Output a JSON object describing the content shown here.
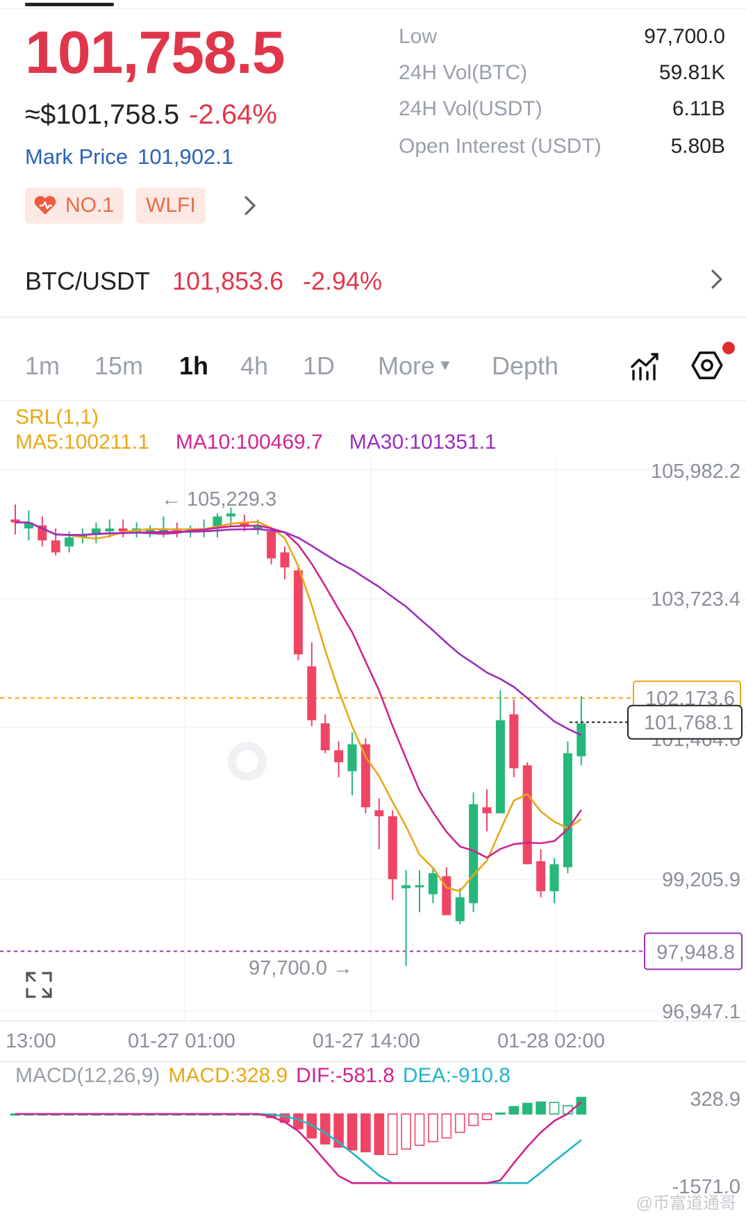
{
  "header": {
    "last_price": "101,758.5",
    "usd_price": "≈$101,758.5",
    "change_pct": "-2.64%",
    "mark_price_label": "Mark Price",
    "mark_price_value": "101,902.1",
    "tags": [
      {
        "label": "NO.1",
        "icon": "heart-icon"
      },
      {
        "label": "WLFI"
      }
    ]
  },
  "stats": [
    {
      "label": "Low",
      "value": "97,700.0"
    },
    {
      "label": "24H Vol(BTC)",
      "value": "59.81K"
    },
    {
      "label": "24H Vol(USDT)",
      "value": "6.11B"
    },
    {
      "label": "Open Interest (USDT)",
      "value": "5.80B"
    }
  ],
  "pair": {
    "name": "BTC/USDT",
    "price": "101,853.6",
    "change": "-2.94%"
  },
  "intervals": {
    "items": [
      "1m",
      "15m",
      "1h",
      "4h",
      "1D",
      "More",
      "Depth"
    ],
    "active": "1h"
  },
  "indicators": {
    "srl": "SRL(1,1)",
    "ma5": "MA5:100211.1",
    "ma10": "MA10:100469.7",
    "ma30": "MA30:101351.1"
  },
  "colors": {
    "up": "#26b77a",
    "down": "#ef4565",
    "ma5": "#e6a817",
    "ma10": "#d0248f",
    "ma30": "#9c2dbb",
    "dea": "#21b5c6",
    "accent_red": "#e0364a",
    "link_blue": "#2a62b8"
  },
  "chart_data": {
    "type": "candlestick",
    "price_axis_labels": [
      "105,982.2",
      "103,723.4",
      "101,464.6",
      "99,205.9",
      "96,947.1"
    ],
    "time_axis_labels": [
      "13:00",
      "01-27 01:00",
      "01-27 14:00",
      "01-28 02:00"
    ],
    "high_marker": "105,229.3",
    "low_marker": "97,700.0",
    "srl_line": "102,173.6",
    "current_price_tag": "101,768.1",
    "purple_line": "97,948.8",
    "candles": [
      {
        "o": 105150,
        "h": 105400,
        "l": 104900,
        "c": 105100
      },
      {
        "o": 105000,
        "h": 105300,
        "l": 104800,
        "c": 105100
      },
      {
        "o": 105050,
        "h": 105200,
        "l": 104700,
        "c": 104800
      },
      {
        "o": 104800,
        "h": 105000,
        "l": 104550,
        "c": 104600
      },
      {
        "o": 104700,
        "h": 104950,
        "l": 104600,
        "c": 104850
      },
      {
        "o": 104850,
        "h": 105000,
        "l": 104750,
        "c": 104900
      },
      {
        "o": 104900,
        "h": 105100,
        "l": 104750,
        "c": 105000
      },
      {
        "o": 104950,
        "h": 105150,
        "l": 104850,
        "c": 105000
      },
      {
        "o": 105000,
        "h": 105150,
        "l": 104850,
        "c": 104950
      },
      {
        "o": 104950,
        "h": 105100,
        "l": 104850,
        "c": 105000
      },
      {
        "o": 104950,
        "h": 105050,
        "l": 104850,
        "c": 105000
      },
      {
        "o": 104950,
        "h": 105200,
        "l": 104850,
        "c": 105000
      },
      {
        "o": 105000,
        "h": 105100,
        "l": 104850,
        "c": 104950
      },
      {
        "o": 104950,
        "h": 105050,
        "l": 104850,
        "c": 105000
      },
      {
        "o": 104950,
        "h": 105150,
        "l": 104850,
        "c": 105000
      },
      {
        "o": 105000,
        "h": 105250,
        "l": 104850,
        "c": 105200
      },
      {
        "o": 105200,
        "h": 105350,
        "l": 105050,
        "c": 105250
      },
      {
        "o": 105100,
        "h": 105230,
        "l": 104950,
        "c": 105050
      },
      {
        "o": 105000,
        "h": 105150,
        "l": 104900,
        "c": 105050
      },
      {
        "o": 104950,
        "h": 105000,
        "l": 104400,
        "c": 104500
      },
      {
        "o": 104600,
        "h": 104700,
        "l": 104150,
        "c": 104350
      },
      {
        "o": 104300,
        "h": 104400,
        "l": 102800,
        "c": 102900
      },
      {
        "o": 102700,
        "h": 103100,
        "l": 101700,
        "c": 101800
      },
      {
        "o": 101750,
        "h": 101900,
        "l": 101250,
        "c": 101300
      },
      {
        "o": 101300,
        "h": 101450,
        "l": 100850,
        "c": 101100
      },
      {
        "o": 100950,
        "h": 101600,
        "l": 100550,
        "c": 101400
      },
      {
        "o": 101400,
        "h": 101500,
        "l": 100250,
        "c": 100350
      },
      {
        "o": 100300,
        "h": 100500,
        "l": 99650,
        "c": 100200
      },
      {
        "o": 100200,
        "h": 100300,
        "l": 98800,
        "c": 99150
      },
      {
        "o": 99000,
        "h": 99300,
        "l": 97700,
        "c": 99050
      },
      {
        "o": 99050,
        "h": 99300,
        "l": 98600,
        "c": 99050
      },
      {
        "o": 98900,
        "h": 99350,
        "l": 98750,
        "c": 99250
      },
      {
        "o": 99200,
        "h": 99350,
        "l": 98600,
        "c": 98550
      },
      {
        "o": 98450,
        "h": 99000,
        "l": 98400,
        "c": 98850
      },
      {
        "o": 98750,
        "h": 100600,
        "l": 98600,
        "c": 100400
      },
      {
        "o": 100350,
        "h": 100650,
        "l": 99950,
        "c": 100250
      },
      {
        "o": 100250,
        "h": 102300,
        "l": 100250,
        "c": 101800
      },
      {
        "o": 101900,
        "h": 102150,
        "l": 100850,
        "c": 101000
      },
      {
        "o": 101050,
        "h": 101100,
        "l": 99400,
        "c": 99400
      },
      {
        "o": 99450,
        "h": 99650,
        "l": 98850,
        "c": 98950
      },
      {
        "o": 98950,
        "h": 99500,
        "l": 98750,
        "c": 99400
      },
      {
        "o": 99350,
        "h": 101450,
        "l": 99250,
        "c": 101250
      },
      {
        "o": 101200,
        "h": 102200,
        "l": 101050,
        "c": 101750
      }
    ]
  },
  "macd": {
    "label": "MACD(12,26,9)",
    "macd": "MACD:328.9",
    "dif": "DIF:-581.8",
    "dea": "DEA:-910.8",
    "axis_top": "328.9",
    "axis_bottom": "-1571.0",
    "histogram": [
      0,
      0,
      0,
      0,
      0,
      0,
      0,
      0,
      0,
      0,
      0,
      0,
      0,
      0,
      0,
      0,
      0,
      0,
      0,
      -80,
      -180,
      -320,
      -520,
      -650,
      -720,
      -780,
      -820,
      -880,
      -880,
      -760,
      -680,
      -600,
      -520,
      -400,
      -250,
      -120,
      20,
      160,
      230,
      260,
      250,
      180,
      360
    ]
  },
  "credit": "@币富道通哥"
}
